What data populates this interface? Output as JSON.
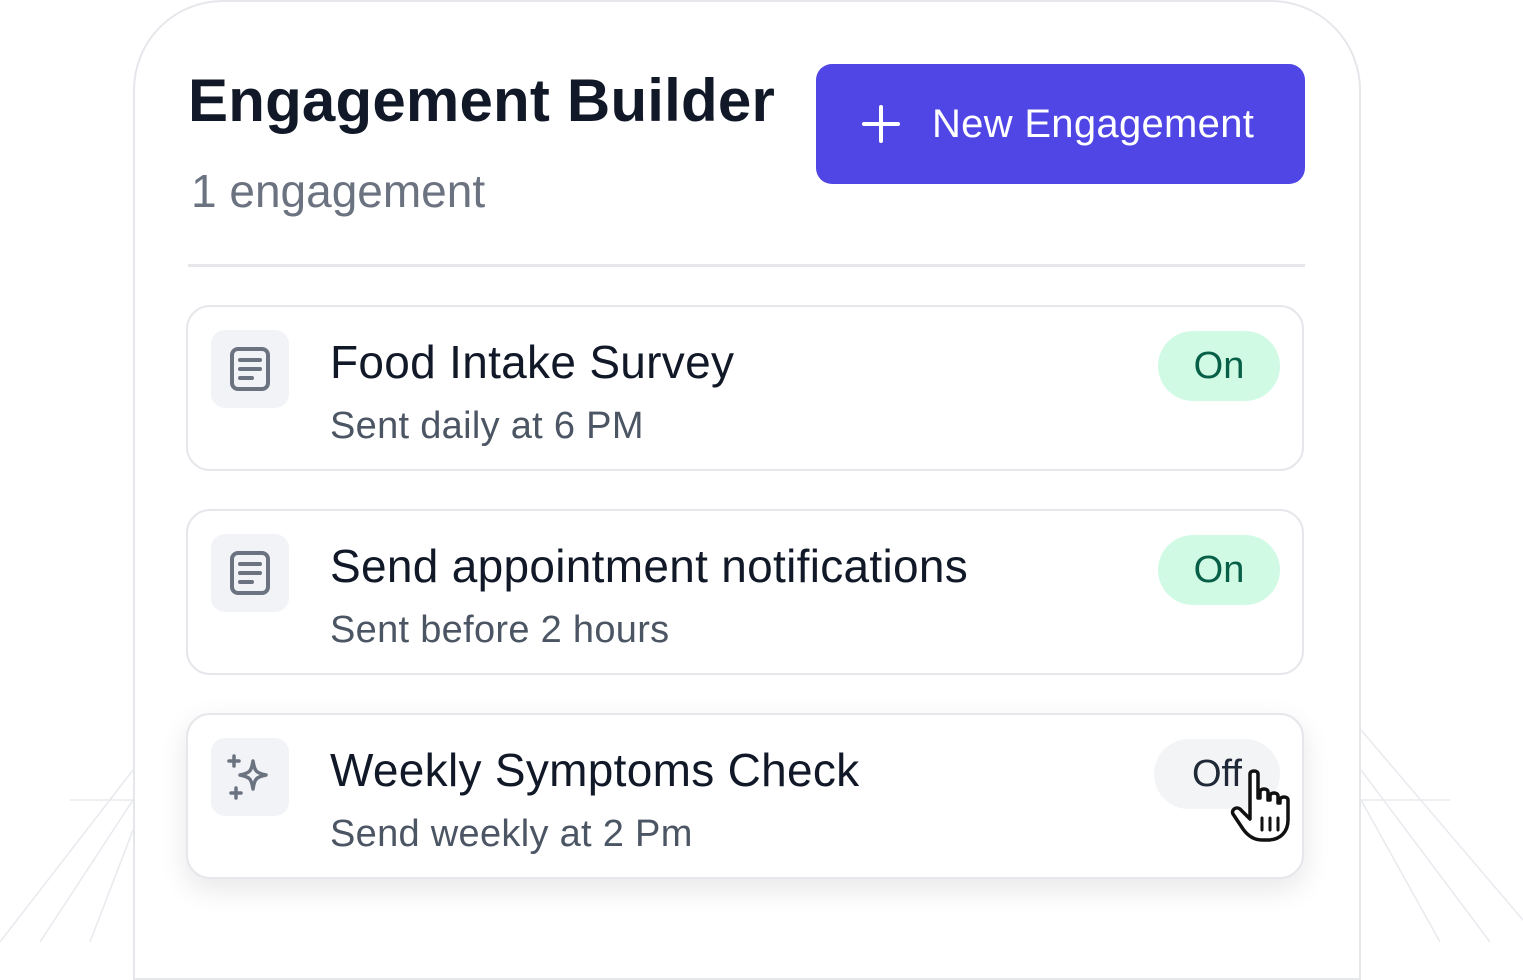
{
  "header": {
    "title": "Engagement Builder",
    "subtitle": "1 engagement",
    "new_button_label": "New Engagement"
  },
  "engagements": [
    {
      "name": "Food Intake Survey",
      "schedule": "Sent daily at 6 PM",
      "status": "On",
      "icon": "document-icon"
    },
    {
      "name": "Send appointment notifications",
      "schedule": "Sent before 2 hours",
      "status": "On",
      "icon": "document-icon"
    },
    {
      "name": "Weekly Symptoms Check",
      "schedule": "Send weekly at 2 Pm",
      "status": "Off",
      "icon": "sparkles-icon"
    }
  ],
  "colors": {
    "accent": "#4f46e5",
    "on_bg": "#d1fae5",
    "on_text": "#065f46",
    "off_bg": "#f3f4f6"
  }
}
